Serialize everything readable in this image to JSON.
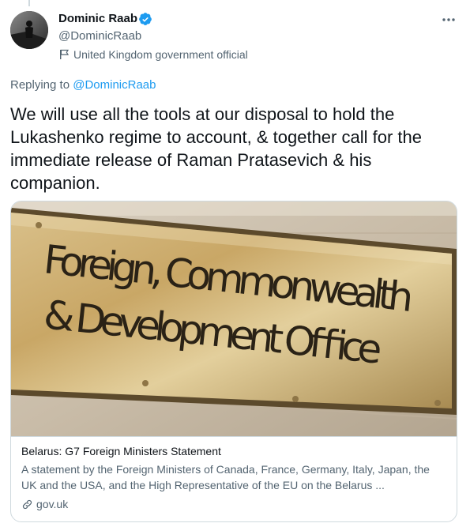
{
  "author": {
    "display_name": "Dominic Raab",
    "handle": "@DominicRaab",
    "label": "United Kingdom government official"
  },
  "tweet": {
    "replying_prefix": "Replying to",
    "replying_to": "@DominicRaab",
    "text": "We will use all the tools at our disposal to hold the Lukashenko regime to account, & together call for the immediate release of Raman Pratasevich & his companion."
  },
  "card": {
    "sign_lines": [
      "Foreign, Commonwealth",
      "& Development Office"
    ],
    "title": "Belarus: G7 Foreign Ministers Statement",
    "description": "A statement by the Foreign Ministers of Canada, France, Germany, Italy, Japan, the UK and the USA, and the High Representative of the EU on the Belarus ...",
    "domain": "gov.uk"
  },
  "colors": {
    "accent": "#1d9bf0",
    "secondary_text": "#536471",
    "border": "#cfd9de"
  }
}
